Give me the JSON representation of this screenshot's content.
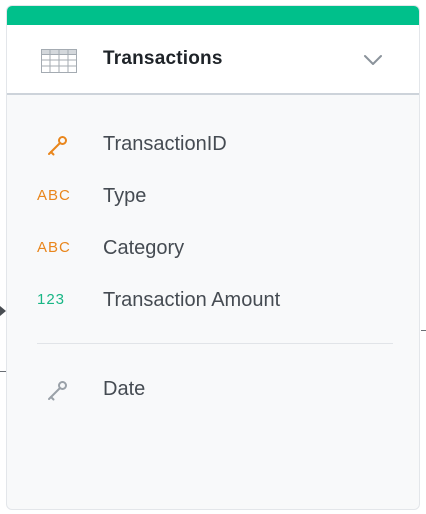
{
  "colors": {
    "accent": "#00c08b",
    "key": "#e9861c",
    "key_muted": "#9aa1a8",
    "text_type": "#e9861c",
    "number_type": "#18b685"
  },
  "dataset": {
    "title": "Transactions",
    "icon": "table-icon",
    "toggle_icon": "chevron-down-icon"
  },
  "fields": [
    {
      "type": "key",
      "icon": "key-icon",
      "label": "TransactionID"
    },
    {
      "type": "text",
      "type_label": "ABC",
      "label": "Type"
    },
    {
      "type": "text",
      "type_label": "ABC",
      "label": "Category"
    },
    {
      "type": "number",
      "type_label": "123",
      "label": "Transaction Amount"
    }
  ],
  "reference_fields": [
    {
      "type": "key-reference",
      "icon": "key-icon",
      "label": "Date"
    }
  ]
}
